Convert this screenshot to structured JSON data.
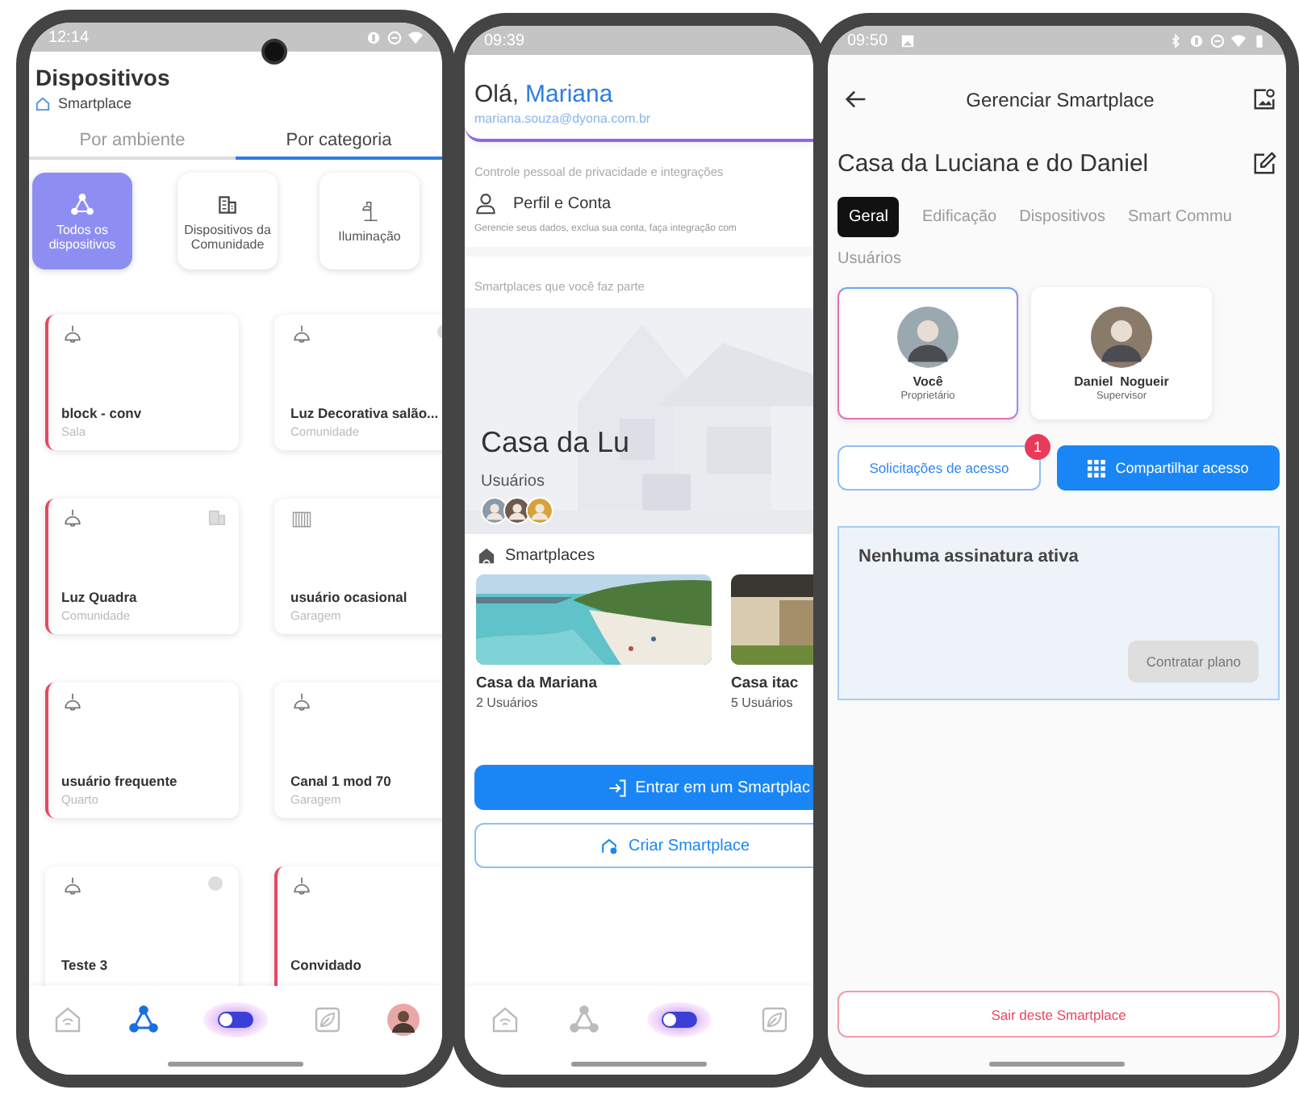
{
  "devices_screen": {
    "status_time": "12:14",
    "title": "Dispositivos",
    "subtitle": "Smartplace",
    "tabs": [
      {
        "label": "Por ambiente",
        "selected": false
      },
      {
        "label": "Por categoria",
        "selected": true
      }
    ],
    "categories": [
      {
        "label": "Todos os dispositivos",
        "kind": "network",
        "selected": true
      },
      {
        "label": "Dispositivos da Comunidade",
        "kind": "building",
        "selected": false
      },
      {
        "label": "Iluminação",
        "kind": "lamp",
        "selected": false
      }
    ],
    "devices": [
      {
        "name": "block - conv",
        "room": "Sala",
        "kind": "lamp",
        "status_dot": false,
        "community": false,
        "alert": true
      },
      {
        "name": "Luz Decorativa salão...",
        "room": "Comunidade",
        "kind": "lamp",
        "status_dot": true,
        "community": false,
        "alert": false
      },
      {
        "name": "Luz Quadra",
        "room": "Comunidade",
        "kind": "lamp",
        "status_dot": false,
        "community": true,
        "alert": true
      },
      {
        "name": "usuário ocasional",
        "room": "Garagem",
        "kind": "radiator",
        "status_dot": false,
        "community": false,
        "alert": false
      },
      {
        "name": "usuário frequente",
        "room": "Quarto",
        "kind": "lamp",
        "status_dot": false,
        "community": false,
        "alert": true
      },
      {
        "name": "Canal 1 mod 70",
        "room": "Garagem",
        "kind": "lamp",
        "status_dot": false,
        "community": false,
        "alert": false
      },
      {
        "name": "Teste 3",
        "kind": "lamp",
        "status_dot": true,
        "community": false,
        "alert": false
      },
      {
        "name": "Convidado",
        "kind": "lamp",
        "status_dot": false,
        "community": false,
        "alert": true
      }
    ],
    "nav": [
      {
        "kind": "home",
        "selected": false
      },
      {
        "kind": "network",
        "selected": true
      },
      {
        "kind": "toggle",
        "selected": false
      },
      {
        "kind": "leaf",
        "selected": false
      },
      {
        "kind": "avatar",
        "selected": false
      }
    ]
  },
  "account_screen": {
    "status_time": "09:39",
    "greeting": "Olá,",
    "user_name": "Mariana",
    "email": "mariana.souza@dyona.com.br",
    "privacy_label": "Controle pessoal de privacidade e integrações",
    "profile_item": "Perfil e Conta",
    "profile_description": "Gerencie seus dados, exclua sua conta, faça integração com",
    "smartplaces_label": "Smartplaces que você faz parte",
    "featured": {
      "title": "Casa da Lu",
      "users_label": "Usuários"
    },
    "smartplaces_heading": "Smartplaces",
    "places": [
      {
        "name": "Casa da Mariana",
        "users": "2 Usuários"
      },
      {
        "name": "Casa itac",
        "users": "5 Usuários"
      }
    ],
    "join_button": "Entrar em um Smartplac",
    "create_button": "Criar Smartplace",
    "nav": [
      {
        "kind": "home",
        "selected": false
      },
      {
        "kind": "network",
        "selected": false
      },
      {
        "kind": "toggle",
        "selected": false
      },
      {
        "kind": "leaf",
        "selected": false
      }
    ]
  },
  "smartplace_screen": {
    "status_time": "09:50",
    "title": "Gerenciar Smartplace",
    "place_name": "Casa da Luciana e do Daniel",
    "tabs": [
      {
        "label": "Geral",
        "selected": true
      },
      {
        "label": "Edificação",
        "selected": false
      },
      {
        "label": "Dispositivos",
        "selected": false
      },
      {
        "label": "Smart Commu",
        "selected": false
      }
    ],
    "users_label": "Usuários",
    "users": [
      {
        "name": "Você",
        "role": "Proprietário",
        "selected": true
      },
      {
        "name": "Daniel  Nogueir",
        "role": "Supervisor",
        "selected": false
      }
    ],
    "requests_button": "Solicitações de acesso",
    "requests_badge": "1",
    "share_button": "Compartilhar acesso",
    "subscription_text": "Nenhuma assinatura ativa",
    "plan_button": "Contratar plano",
    "leave_button": "Sair deste Smartplace"
  }
}
